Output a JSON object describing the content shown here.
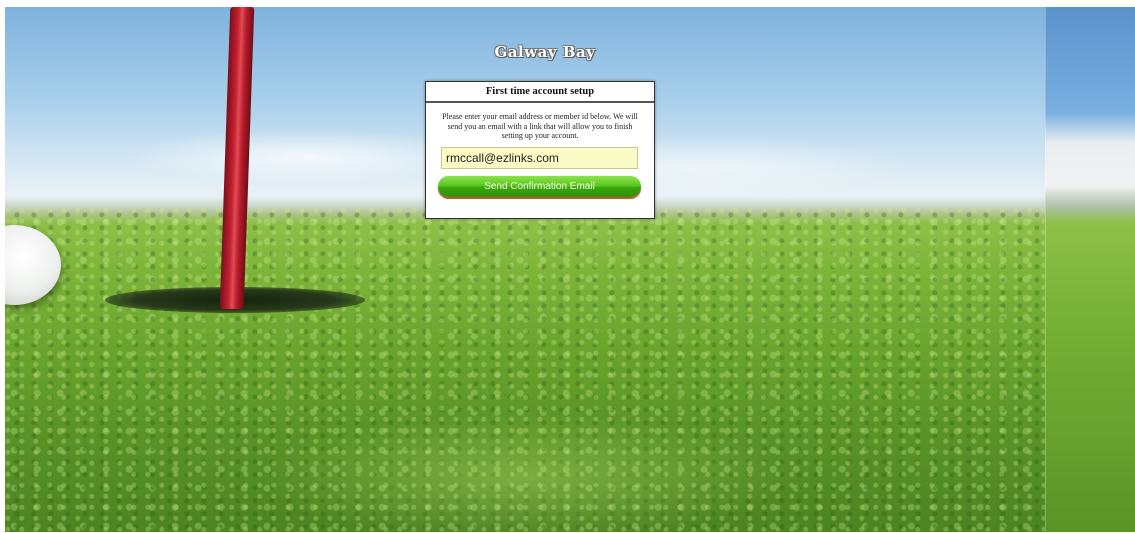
{
  "page": {
    "title": "Galway Bay"
  },
  "dialog": {
    "heading": "First time account setup",
    "instructions": "Please enter your email address or member id below. We will send you an email with a link that will allow you to finish setting up your account.",
    "email_value": "rmccall@ezlinks.com",
    "send_button_label": "Send Confirmation Email"
  },
  "colors": {
    "button_green": "#4cbb17",
    "input_background": "#fbfbc6",
    "flag_red": "#c42131"
  }
}
